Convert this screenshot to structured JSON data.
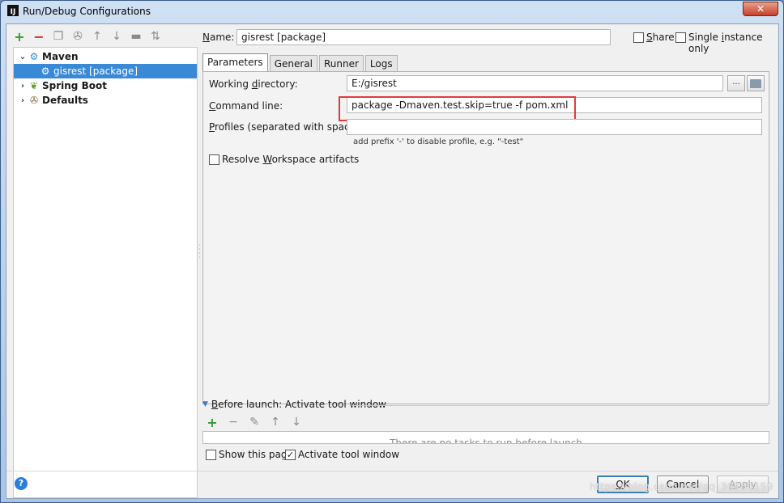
{
  "window": {
    "title": "Run/Debug Configurations",
    "close_glyph": "✕",
    "app_icon_glyph": "IJ"
  },
  "toolbar": {
    "icons": [
      "add-icon",
      "remove-icon",
      "copy-icon",
      "wrench-icon",
      "move-up-icon",
      "move-down-icon",
      "folder-icon",
      "sort-icon"
    ],
    "add_glyph": "+",
    "remove_glyph": "−",
    "copy_glyph": "❐",
    "wrench_glyph": "✇",
    "up_glyph": "↑",
    "down_glyph": "↓",
    "folder_glyph": "▬",
    "sort_glyph": "⇅"
  },
  "tree": {
    "maven": {
      "label": "Maven",
      "arrow": "⌄",
      "icon": "⚙"
    },
    "gisrest": {
      "label": "gisrest [package]",
      "icon": "⚙"
    },
    "spring": {
      "label": "Spring Boot",
      "arrow": "›",
      "icon": "❦"
    },
    "defaults": {
      "label": "Defaults",
      "arrow": "›",
      "icon": "✇"
    }
  },
  "name_row": {
    "label_underlined": "N",
    "label_rest": "ame:",
    "value": "gisrest [package]",
    "share_underlined": "S",
    "share_rest": "hare",
    "single_pre": "Single ",
    "single_underlined": "i",
    "single_rest": "nstance only"
  },
  "tabs": [
    "Parameters",
    "General",
    "Runner",
    "Logs"
  ],
  "parameters": {
    "working_dir_pre": "Working ",
    "working_dir_u": "d",
    "working_dir_rest": "irectory:",
    "working_dir_value": "E:/gisrest",
    "browse_glyph": "...",
    "command_u": "C",
    "command_rest": "ommand line:",
    "command_value": "package -Dmaven.test.skip=true -f pom.xml",
    "profiles_u": "P",
    "profiles_rest": "rofiles (separated with space):",
    "profiles_value": "",
    "profiles_hint": "add prefix '-' to disable profile, e.g. \"-test\"",
    "resolve_pre": "Resolve ",
    "resolve_u": "W",
    "resolve_rest": "orkspace artifacts"
  },
  "before_launch": {
    "triangle": "▼",
    "title_u": "B",
    "title_rest": "efore launch: Activate tool window",
    "add_glyph": "+",
    "remove_glyph": "−",
    "edit_glyph": "✎",
    "up_glyph": "↑",
    "down_glyph": "↓",
    "empty_text": "There are no tasks to run before launch",
    "show_page_label": "Show this page",
    "activate_label": "Activate tool window",
    "activate_check": "✓"
  },
  "footer": {
    "help_glyph": "?",
    "ok_u": "O",
    "ok_rest": "K",
    "cancel": "Cancel",
    "apply_u": "A",
    "apply_rest": "pply",
    "watermark": "https://blog.csdn.net/qq_36161159"
  },
  "colors": {
    "accent": "#3a89d6",
    "highlight": "#e23b3b"
  }
}
